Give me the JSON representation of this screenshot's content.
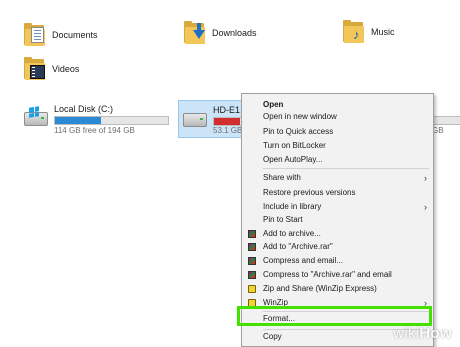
{
  "folders": {
    "documents": "Documents",
    "downloads": "Downloads",
    "music": "Music",
    "videos": "Videos"
  },
  "drives": [
    {
      "name": "Local Disk (C:)",
      "free_text": "114 GB free of 194 GB",
      "used_fraction": 0.41,
      "bar_color": "#2a8ad4",
      "selected": false
    },
    {
      "name": "HD-E1 (E",
      "free_text": "53.1 GB fr",
      "used_fraction": 0.65,
      "bar_color": "#d32f2f",
      "selected": true
    },
    {
      "name": "",
      "free_text": "GB",
      "used_fraction": null,
      "bar_color": "#e6e6e6",
      "selected": false
    }
  ],
  "context_menu": {
    "items": [
      {
        "label": "Open",
        "bold": true
      },
      {
        "label": "Open in new window"
      },
      {
        "label": "Pin to Quick access"
      },
      {
        "label": "Turn on BitLocker"
      },
      {
        "label": "Open AutoPlay..."
      },
      {
        "label": "Share with",
        "submenu": true
      },
      {
        "label": "Restore previous versions"
      },
      {
        "label": "Include in library",
        "submenu": true
      },
      {
        "label": "Pin to Start"
      },
      {
        "label": "Add to archive...",
        "icon": "rar-icon"
      },
      {
        "label": "Add to \"Archive.rar\"",
        "icon": "rar-icon"
      },
      {
        "label": "Compress and email...",
        "icon": "rar-icon"
      },
      {
        "label": "Compress to \"Archive.rar\" and email",
        "icon": "rar-icon"
      },
      {
        "label": "Zip and Share (WinZip Express)",
        "icon": "winzip-icon"
      },
      {
        "label": "WinZip",
        "icon": "winzip-icon",
        "submenu": true
      },
      {
        "label": "Format...",
        "highlighted": true
      },
      {
        "label": "Copy"
      }
    ],
    "highlight_color": "#43e000"
  },
  "watermark": {
    "prefix": "wiki",
    "suffix": "How"
  }
}
